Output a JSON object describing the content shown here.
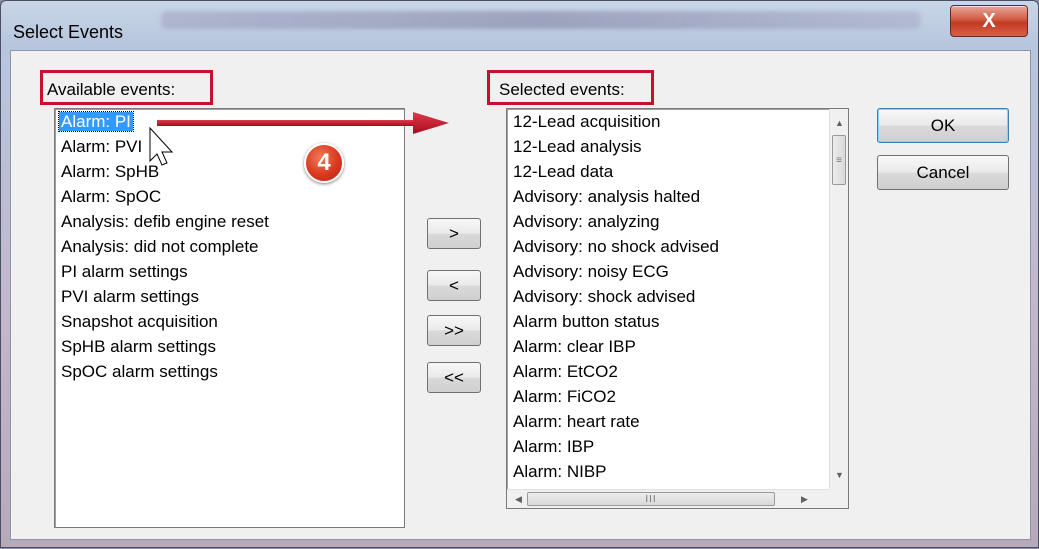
{
  "window": {
    "title": "Select Events",
    "close_label": "X"
  },
  "available": {
    "label": "Available events:",
    "items": [
      "Alarm: PI",
      "Alarm: PVI",
      "Alarm: SpHB",
      "Alarm: SpOC",
      "Analysis: defib engine reset",
      "Analysis: did not complete",
      "PI alarm settings",
      "PVI alarm settings",
      "Snapshot acquisition",
      "SpHB alarm settings",
      "SpOC alarm settings"
    ],
    "selected_index": 0
  },
  "selected": {
    "label": "Selected events:",
    "items": [
      "12-Lead acquisition",
      "12-Lead analysis",
      "12-Lead data",
      "Advisory: analysis halted",
      "Advisory: analyzing",
      "Advisory: no shock advised",
      "Advisory: noisy ECG",
      "Advisory: shock advised",
      "Alarm button status",
      "Alarm: clear IBP",
      "Alarm: EtCO2",
      "Alarm: FiCO2",
      "Alarm: heart rate",
      "Alarm: IBP",
      "Alarm: NIBP"
    ]
  },
  "transfer_buttons": {
    "add": ">",
    "remove": "<",
    "add_all": ">>",
    "remove_all": "<<"
  },
  "actions": {
    "ok": "OK",
    "cancel": "Cancel"
  },
  "annotation": {
    "step_number": "4",
    "arrow_color": "#c8102e"
  },
  "scrollbar": {
    "up_icon": "▲",
    "down_icon": "▼",
    "left_icon": "◀",
    "right_icon": "▶",
    "grip": "≡",
    "hgrip": "III"
  }
}
